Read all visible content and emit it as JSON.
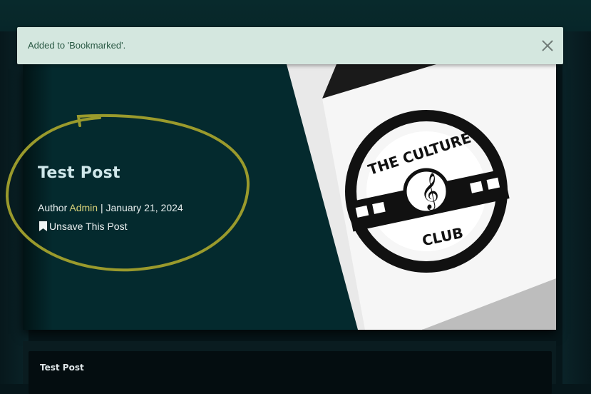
{
  "toast": {
    "message": "Added to 'Bookmarked'.",
    "close_icon": "close-icon"
  },
  "post": {
    "title": "Test Post",
    "author_prefix": "Author",
    "author_name": "Admin",
    "separator": "|",
    "date": "January 21, 2024",
    "unsave_label": "Unsave This Post",
    "bookmark_icon": "bookmark-icon"
  },
  "hero_image": {
    "logo_text_top": "THE CULTURE",
    "logo_text_bottom": "CLUB",
    "colors": {
      "card": "#ffffff",
      "background": "#042a2e",
      "ink": "#111111"
    }
  },
  "card": {
    "title": "Test Post"
  },
  "colors": {
    "accent_link": "#d8d27a",
    "toast_bg": "#d4e7df",
    "toast_text": "#2b5a45",
    "annotation": "#9a9a2c"
  }
}
